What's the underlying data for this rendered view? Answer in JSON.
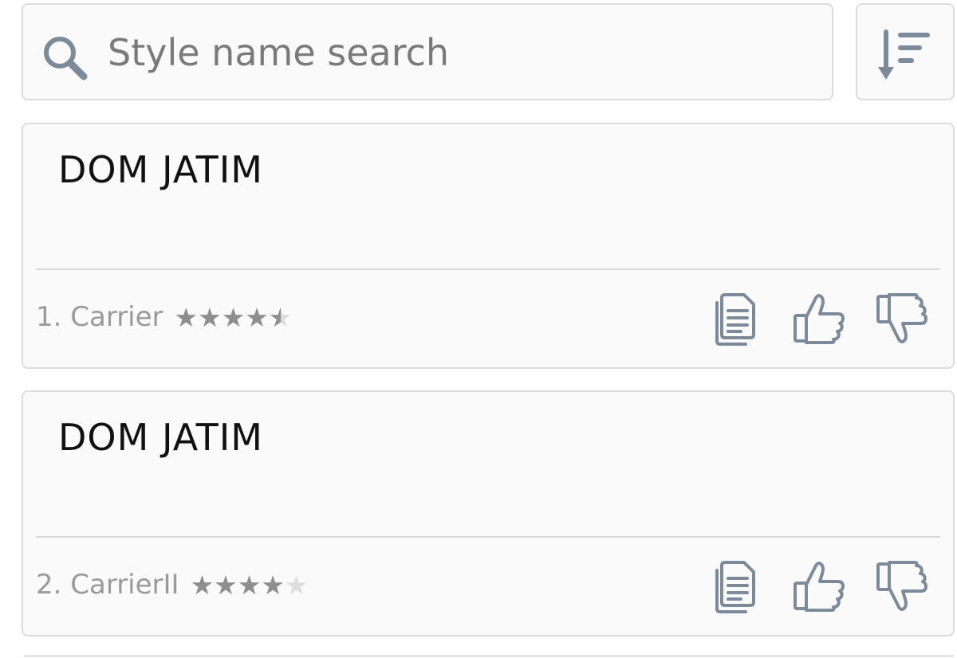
{
  "search": {
    "placeholder": "Style name search",
    "value": ""
  },
  "icons": {
    "search": "search-icon",
    "sort": "sort-descending-icon",
    "copy": "copy-icon",
    "like": "thumbs-up-icon",
    "dislike": "thumbs-down-icon"
  },
  "colors": {
    "icon": "#7d8a99",
    "star_filled": "#8e8e8e",
    "star_empty": "#dddddd",
    "border": "#dcdcdc"
  },
  "styles": [
    {
      "preview_text": "DOM JATIM",
      "name": "1. Carrier",
      "rating": 4.5,
      "rating_max": 5
    },
    {
      "preview_text": "DOM JATIM",
      "name": "2. CarrierII",
      "rating": 4,
      "rating_max": 5
    }
  ]
}
